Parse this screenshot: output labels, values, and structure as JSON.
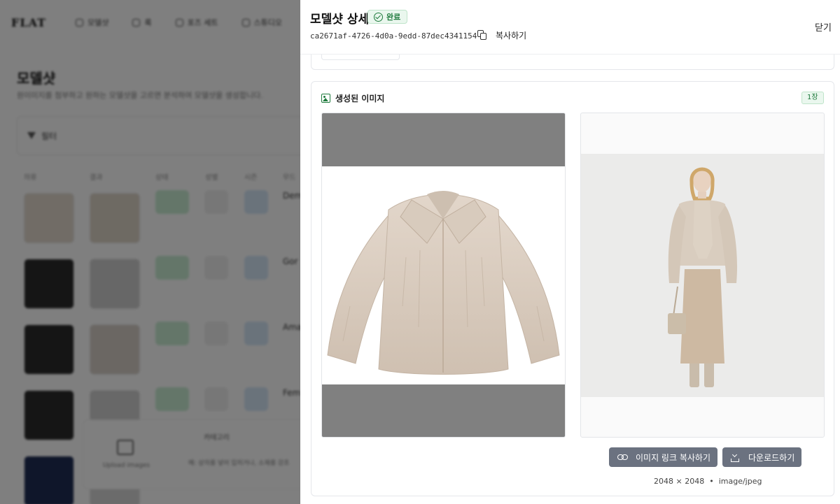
{
  "background": {
    "logo": "FLAT",
    "nav": [
      "모델샷",
      "룩",
      "포즈 세트",
      "스튜디오",
      "프"
    ],
    "page_title": "모델샷",
    "page_subtitle": "원이미지를 첨부하고 원하는 모델샷을 고르면 분석하여 모델샷을 생성합니다.",
    "filter_label": "필터",
    "columns": [
      "의류",
      "결과",
      "상태",
      "성별",
      "시즌",
      "무드"
    ],
    "rows": [
      "Dem",
      "Gor",
      "Ama",
      "Fem"
    ],
    "popover_label": "Upload images",
    "popover_category": "카테고리",
    "popover_hint": "예: 상의를 넣어 입히거나, 소재를 강조"
  },
  "panel": {
    "title": "모델샷 상세",
    "status": "완료",
    "job_id": "ca2671af-4726-4d0a-9edd-87dec4341154",
    "copy_label": "복사하기",
    "close_label": "닫기"
  },
  "generated": {
    "title": "생성된 이미지",
    "count": "1장",
    "copy_link_label": "이미지 링크 복사하기",
    "download_label": "다운로드하기",
    "dimensions": "2048 × 2048",
    "separator": "•",
    "format": "image/jpeg"
  },
  "colors": {
    "status_green": "#1e7a3c",
    "status_bg": "#eaf7ee",
    "button_gray": "#6b7280",
    "fur_beige": "#d9cbbd"
  }
}
